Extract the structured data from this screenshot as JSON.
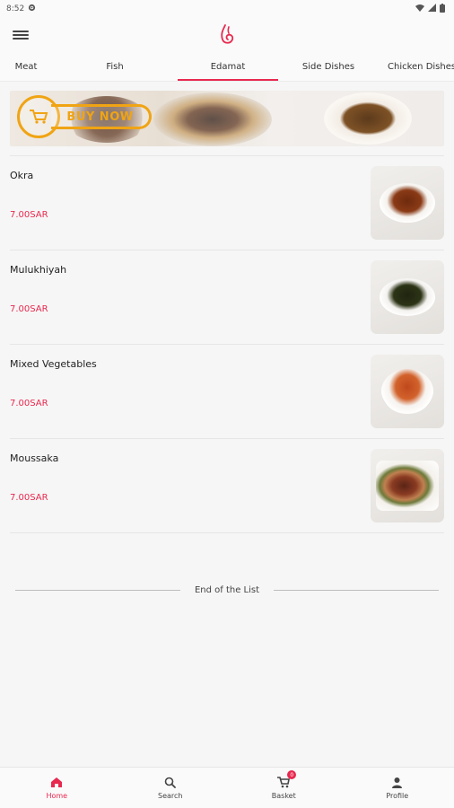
{
  "status_bar": {
    "time": "8:52"
  },
  "colors": {
    "accent": "#e8294f",
    "buy_now": "#f0a414"
  },
  "tabs": [
    {
      "label": "Meat"
    },
    {
      "label": "Fish"
    },
    {
      "label": "Edamat"
    },
    {
      "label": "Side Dishes"
    },
    {
      "label": "Chicken Dishes Wi"
    }
  ],
  "active_tab": "Edamat",
  "banner": {
    "label": "BUY NOW"
  },
  "items": [
    {
      "name": "Okra",
      "price": "7.00SAR",
      "image": "okra-stew"
    },
    {
      "name": "Mulukhiyah",
      "price": "7.00SAR",
      "image": "mulukhiyah-bowl"
    },
    {
      "name": "Mixed Vegetables",
      "price": "7.00SAR",
      "image": "mixed-vegetables-bowl"
    },
    {
      "name": "Moussaka",
      "price": "7.00SAR",
      "image": "moussaka-plate"
    }
  ],
  "end_of_list": "End of the List",
  "bottom_nav": [
    {
      "label": "Home",
      "icon": "home-icon",
      "active": true
    },
    {
      "label": "Search",
      "icon": "search-icon",
      "active": false
    },
    {
      "label": "Basket",
      "icon": "cart-icon",
      "active": false,
      "badge": "0"
    },
    {
      "label": "Profile",
      "icon": "profile-icon",
      "active": false
    }
  ]
}
